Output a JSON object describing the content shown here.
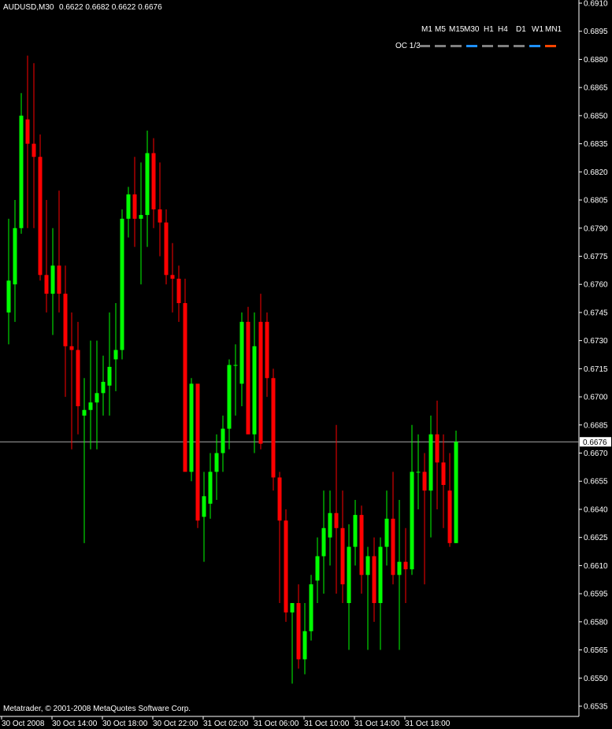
{
  "header": {
    "symbol_timeframe": "AUDUSD,M30",
    "ohlc": "0.6622 0.6682 0.6622 0.6676"
  },
  "footer": {
    "copyright": "Metatrader, © 2001-2008 MetaQuotes Software Corp."
  },
  "timeframe_panel": {
    "labels": [
      "M1",
      "M5",
      "M15",
      "M30",
      "H1",
      "H4",
      "D1",
      "W1",
      "MN1"
    ],
    "row_label": "OC 1/3",
    "states": [
      "neutral",
      "neutral",
      "neutral",
      "up",
      "neutral",
      "neutral",
      "neutral",
      "up",
      "down"
    ]
  },
  "colors": {
    "background": "#000000",
    "bull": "#00ff00",
    "bear": "#ff0000",
    "axis": "#ffffff",
    "price_line": "#a9a9a9",
    "neutral": "#808080",
    "up": "#1e90ff",
    "down": "#ff4500"
  },
  "chart_data": {
    "type": "candlestick",
    "title": "AUDUSD,M30",
    "current_price": 0.6676,
    "current_price_label": "0.6676",
    "y_range": [
      0.6532,
      0.6912
    ],
    "y_ticks": [
      "0.6910",
      "0.6895",
      "0.6880",
      "0.6865",
      "0.6850",
      "0.6835",
      "0.6820",
      "0.6805",
      "0.6790",
      "0.6775",
      "0.6760",
      "0.6745",
      "0.6730",
      "0.6715",
      "0.6700",
      "0.6685",
      "0.6670",
      "0.6655",
      "0.6640",
      "0.6625",
      "0.6610",
      "0.6595",
      "0.6580",
      "0.6565",
      "0.6550",
      "0.6535"
    ],
    "x_ticks": [
      "30 Oct 2008",
      "30 Oct 14:00",
      "30 Oct 18:00",
      "30 Oct 22:00",
      "31 Oct 02:00",
      "31 Oct 06:00",
      "31 Oct 10:00",
      "31 Oct 14:00",
      "31 Oct 18:00"
    ],
    "candles": [
      {
        "o": 0.6745,
        "h": 0.6795,
        "l": 0.6728,
        "c": 0.6762
      },
      {
        "o": 0.676,
        "h": 0.6805,
        "l": 0.674,
        "c": 0.679
      },
      {
        "o": 0.679,
        "h": 0.6862,
        "l": 0.6787,
        "c": 0.685
      },
      {
        "o": 0.6848,
        "h": 0.6882,
        "l": 0.679,
        "c": 0.6835
      },
      {
        "o": 0.6835,
        "h": 0.6878,
        "l": 0.679,
        "c": 0.6828
      },
      {
        "o": 0.6828,
        "h": 0.684,
        "l": 0.6762,
        "c": 0.6765
      },
      {
        "o": 0.6765,
        "h": 0.6805,
        "l": 0.6745,
        "c": 0.6755
      },
      {
        "o": 0.6755,
        "h": 0.679,
        "l": 0.6733,
        "c": 0.677
      },
      {
        "o": 0.677,
        "h": 0.681,
        "l": 0.6745,
        "c": 0.6755
      },
      {
        "o": 0.6755,
        "h": 0.677,
        "l": 0.67,
        "c": 0.6727
      },
      {
        "o": 0.6727,
        "h": 0.6745,
        "l": 0.6672,
        "c": 0.6725
      },
      {
        "o": 0.6725,
        "h": 0.674,
        "l": 0.668,
        "c": 0.6695
      },
      {
        "o": 0.669,
        "h": 0.671,
        "l": 0.6622,
        "c": 0.6693
      },
      {
        "o": 0.6693,
        "h": 0.673,
        "l": 0.6672,
        "c": 0.6697
      },
      {
        "o": 0.6697,
        "h": 0.673,
        "l": 0.6672,
        "c": 0.6702
      },
      {
        "o": 0.6702,
        "h": 0.6722,
        "l": 0.669,
        "c": 0.6708
      },
      {
        "o": 0.6706,
        "h": 0.6745,
        "l": 0.669,
        "c": 0.6716
      },
      {
        "o": 0.672,
        "h": 0.675,
        "l": 0.6703,
        "c": 0.6725
      },
      {
        "o": 0.6725,
        "h": 0.68,
        "l": 0.672,
        "c": 0.6795
      },
      {
        "o": 0.6795,
        "h": 0.6812,
        "l": 0.6785,
        "c": 0.6808
      },
      {
        "o": 0.6808,
        "h": 0.6828,
        "l": 0.678,
        "c": 0.6795
      },
      {
        "o": 0.6795,
        "h": 0.6825,
        "l": 0.676,
        "c": 0.6797
      },
      {
        "o": 0.6797,
        "h": 0.6842,
        "l": 0.678,
        "c": 0.683
      },
      {
        "o": 0.683,
        "h": 0.6838,
        "l": 0.679,
        "c": 0.68
      },
      {
        "o": 0.68,
        "h": 0.6825,
        "l": 0.6775,
        "c": 0.6793
      },
      {
        "o": 0.6793,
        "h": 0.68,
        "l": 0.676,
        "c": 0.6765
      },
      {
        "o": 0.6765,
        "h": 0.6782,
        "l": 0.6745,
        "c": 0.6763
      },
      {
        "o": 0.6763,
        "h": 0.677,
        "l": 0.674,
        "c": 0.675
      },
      {
        "o": 0.675,
        "h": 0.6763,
        "l": 0.668,
        "c": 0.666
      },
      {
        "o": 0.666,
        "h": 0.671,
        "l": 0.6655,
        "c": 0.6707
      },
      {
        "o": 0.6707,
        "h": 0.67,
        "l": 0.663,
        "c": 0.6634
      },
      {
        "o": 0.6636,
        "h": 0.666,
        "l": 0.6612,
        "c": 0.6647
      },
      {
        "o": 0.6643,
        "h": 0.667,
        "l": 0.6635,
        "c": 0.666
      },
      {
        "o": 0.666,
        "h": 0.668,
        "l": 0.6645,
        "c": 0.667
      },
      {
        "o": 0.667,
        "h": 0.669,
        "l": 0.666,
        "c": 0.6683
      },
      {
        "o": 0.6683,
        "h": 0.672,
        "l": 0.6672,
        "c": 0.6717
      },
      {
        "o": 0.6717,
        "h": 0.6728,
        "l": 0.669,
        "c": 0.6717
      },
      {
        "o": 0.6707,
        "h": 0.6745,
        "l": 0.6695,
        "c": 0.674
      },
      {
        "o": 0.674,
        "h": 0.6748,
        "l": 0.67,
        "c": 0.668
      },
      {
        "o": 0.668,
        "h": 0.6745,
        "l": 0.667,
        "c": 0.6727
      },
      {
        "o": 0.674,
        "h": 0.6755,
        "l": 0.6672,
        "c": 0.6675
      },
      {
        "o": 0.674,
        "h": 0.6745,
        "l": 0.67,
        "c": 0.671
      },
      {
        "o": 0.671,
        "h": 0.6715,
        "l": 0.665,
        "c": 0.6657
      },
      {
        "o": 0.6657,
        "h": 0.666,
        "l": 0.659,
        "c": 0.6634
      },
      {
        "o": 0.6634,
        "h": 0.664,
        "l": 0.658,
        "c": 0.6585
      },
      {
        "o": 0.6585,
        "h": 0.659,
        "l": 0.6547,
        "c": 0.659
      },
      {
        "o": 0.659,
        "h": 0.66,
        "l": 0.6555,
        "c": 0.656
      },
      {
        "o": 0.656,
        "h": 0.659,
        "l": 0.6552,
        "c": 0.6575
      },
      {
        "o": 0.6575,
        "h": 0.6605,
        "l": 0.657,
        "c": 0.66
      },
      {
        "o": 0.6602,
        "h": 0.6625,
        "l": 0.659,
        "c": 0.6615
      },
      {
        "o": 0.6615,
        "h": 0.665,
        "l": 0.6595,
        "c": 0.663
      },
      {
        "o": 0.6625,
        "h": 0.665,
        "l": 0.661,
        "c": 0.6638
      },
      {
        "o": 0.6638,
        "h": 0.6685,
        "l": 0.6595,
        "c": 0.663
      },
      {
        "o": 0.663,
        "h": 0.665,
        "l": 0.659,
        "c": 0.66
      },
      {
        "o": 0.659,
        "h": 0.6632,
        "l": 0.6565,
        "c": 0.662
      },
      {
        "o": 0.662,
        "h": 0.6645,
        "l": 0.661,
        "c": 0.6637
      },
      {
        "o": 0.6637,
        "h": 0.6642,
        "l": 0.6595,
        "c": 0.6605
      },
      {
        "o": 0.6605,
        "h": 0.662,
        "l": 0.6565,
        "c": 0.6615
      },
      {
        "o": 0.6615,
        "h": 0.6625,
        "l": 0.658,
        "c": 0.659
      },
      {
        "o": 0.659,
        "h": 0.6625,
        "l": 0.6565,
        "c": 0.662
      },
      {
        "o": 0.662,
        "h": 0.665,
        "l": 0.661,
        "c": 0.6635
      },
      {
        "o": 0.6635,
        "h": 0.666,
        "l": 0.66,
        "c": 0.6605
      },
      {
        "o": 0.6605,
        "h": 0.6645,
        "l": 0.6565,
        "c": 0.6612
      },
      {
        "o": 0.6612,
        "h": 0.663,
        "l": 0.659,
        "c": 0.6608
      },
      {
        "o": 0.6608,
        "h": 0.6685,
        "l": 0.6605,
        "c": 0.666
      },
      {
        "o": 0.666,
        "h": 0.668,
        "l": 0.664,
        "c": 0.666
      },
      {
        "o": 0.666,
        "h": 0.667,
        "l": 0.66,
        "c": 0.665
      },
      {
        "o": 0.665,
        "h": 0.669,
        "l": 0.6625,
        "c": 0.668
      },
      {
        "o": 0.668,
        "h": 0.6698,
        "l": 0.664,
        "c": 0.6665
      },
      {
        "o": 0.6665,
        "h": 0.668,
        "l": 0.663,
        "c": 0.6653
      },
      {
        "o": 0.665,
        "h": 0.667,
        "l": 0.662,
        "c": 0.6622
      },
      {
        "o": 0.6622,
        "h": 0.6682,
        "l": 0.6622,
        "c": 0.6676
      }
    ]
  }
}
